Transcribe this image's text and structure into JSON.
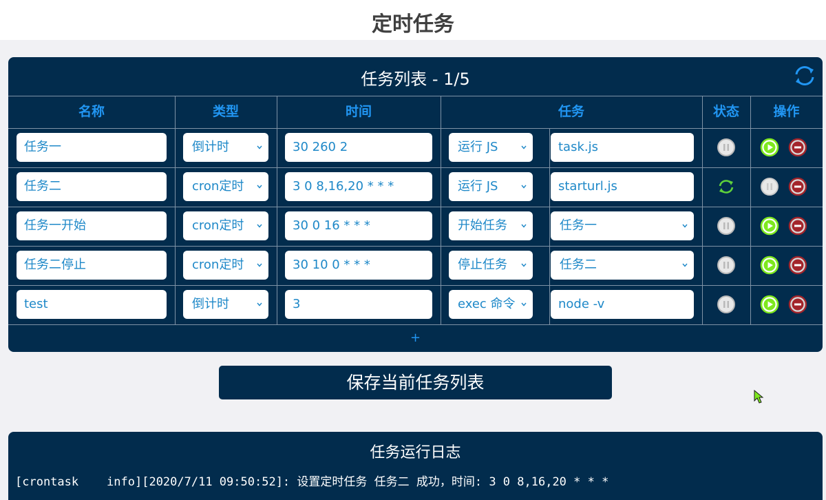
{
  "page": {
    "title": "定时任务"
  },
  "task_panel": {
    "title": "任务列表 - 1/5",
    "headers": {
      "name": "名称",
      "type": "类型",
      "time": "时间",
      "task": "任务",
      "status": "状态",
      "ops": "操作"
    },
    "rows": [
      {
        "name": "任务一",
        "type": "倒计时",
        "time": "30 260 2",
        "action": "运行 JS",
        "target": "task.js",
        "target_is_select": false,
        "status": "paused",
        "status_icon": "pause-icon",
        "show_start": true
      },
      {
        "name": "任务二",
        "type": "cron定时",
        "time": "3 0 8,16,20 * * *",
        "action": "运行 JS",
        "target": "starturl.js",
        "target_is_select": false,
        "status": "running",
        "status_icon": "sync-icon",
        "show_start": false
      },
      {
        "name": "任务一开始",
        "type": "cron定时",
        "time": "30 0 16 * * *",
        "action": "开始任务",
        "target": "任务一",
        "target_is_select": true,
        "status": "paused",
        "status_icon": "pause-icon",
        "show_start": true
      },
      {
        "name": "任务二停止",
        "type": "cron定时",
        "time": "30 10 0 * * *",
        "action": "停止任务",
        "target": "任务二",
        "target_is_select": true,
        "status": "paused",
        "status_icon": "pause-icon",
        "show_start": true
      },
      {
        "name": "test",
        "type": "倒计时",
        "time": "3",
        "action": "exec 命令",
        "target": "node -v",
        "target_is_select": false,
        "status": "paused",
        "status_icon": "pause-icon",
        "show_start": true
      }
    ],
    "add_label": "+"
  },
  "save_button": {
    "label": "保存当前任务列表"
  },
  "log_panel": {
    "title": "任务运行日志",
    "lines": [
      "[crontask    info][2020/7/11 09:50:52]: 设置定时任务 任务二 成功，时间: 3 0 8,16,20 * * *"
    ]
  },
  "colors": {
    "panel": "#022c4d",
    "header_text": "#2196f3",
    "field_text": "#1e88c8",
    "start_green": "#7ee81f",
    "stop_red": "#a3252b",
    "running_green": "#5fd13b"
  }
}
